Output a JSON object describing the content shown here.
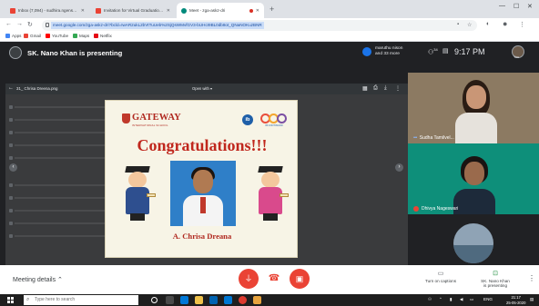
{
  "browser": {
    "tabs": [
      {
        "title": "Inbox (7,094) - sudhira.ngenston...",
        "favicon": "gmail-icon",
        "active": false
      },
      {
        "title": "Invitation for Virtual Graduation ...",
        "favicon": "gmail-icon",
        "active": false
      },
      {
        "title": "Meet - zga-askz-dri",
        "favicon": "meet-icon",
        "active": true,
        "recording": true
      }
    ],
    "new_tab": "+",
    "url": "meet.google.com/zga-askz-dri?bcld=IwAR2ukL2bVtTuUeb%2SjQsWMvfGV3-bUHcI9BL0db8ot_QNaNOKuzBNR",
    "bookmarks": [
      {
        "label": "Apps",
        "icon": "apps-icon",
        "color": "#4285f4"
      },
      {
        "label": "Gmail",
        "icon": "gmail-icon",
        "color": "#ea4335"
      },
      {
        "label": "YouTube",
        "icon": "youtube-icon",
        "color": "#ff0000"
      },
      {
        "label": "Maps",
        "icon": "maps-icon",
        "color": "#34a853"
      },
      {
        "label": "Netflix",
        "icon": "netflix-icon",
        "color": "#e50914"
      }
    ]
  },
  "meet": {
    "presenter_banner": "SK. Nano Khan is presenting",
    "participants_chip": {
      "line1": "maruthu nison",
      "line2": "and 33 more"
    },
    "people_count": "34",
    "time": "9:17 PM",
    "self_label": "You"
  },
  "shared_screen": {
    "file_title": "31_ Chrisa Dreena.png",
    "open_with": "Open with ▾",
    "zoom": "—  ⊕  +"
  },
  "slide": {
    "school_name": "GATEWAY",
    "school_sub": "INTERNATIONAL SCHOOL",
    "ib_badge": "ib",
    "rings_label": "IB CONTINUUM",
    "headline": "Congratulations!!!",
    "student_name": "A. Chrisa Dreana"
  },
  "participants": [
    {
      "name": "Sudha Tamilvel...",
      "muted": false
    },
    {
      "name": "Dhivya Nageswari",
      "muted": true
    },
    {
      "name": "",
      "muted": false
    }
  ],
  "bottom_bar": {
    "meeting_details": "Meeting details",
    "captions_label": "Turn on captions",
    "presenting_label_1": "SK. Nano Khan",
    "presenting_label_2": "is presenting"
  },
  "taskbar": {
    "search_placeholder": "Type here to search",
    "language": "ENG",
    "clock_time": "21:17",
    "clock_date": "25-05-2020"
  },
  "colors": {
    "meet_background": "#202124",
    "mute_red": "#ea4335",
    "slide_red": "#c0271d",
    "slide_cream": "#f7f4e6",
    "accent_blue": "#1a73e8"
  }
}
